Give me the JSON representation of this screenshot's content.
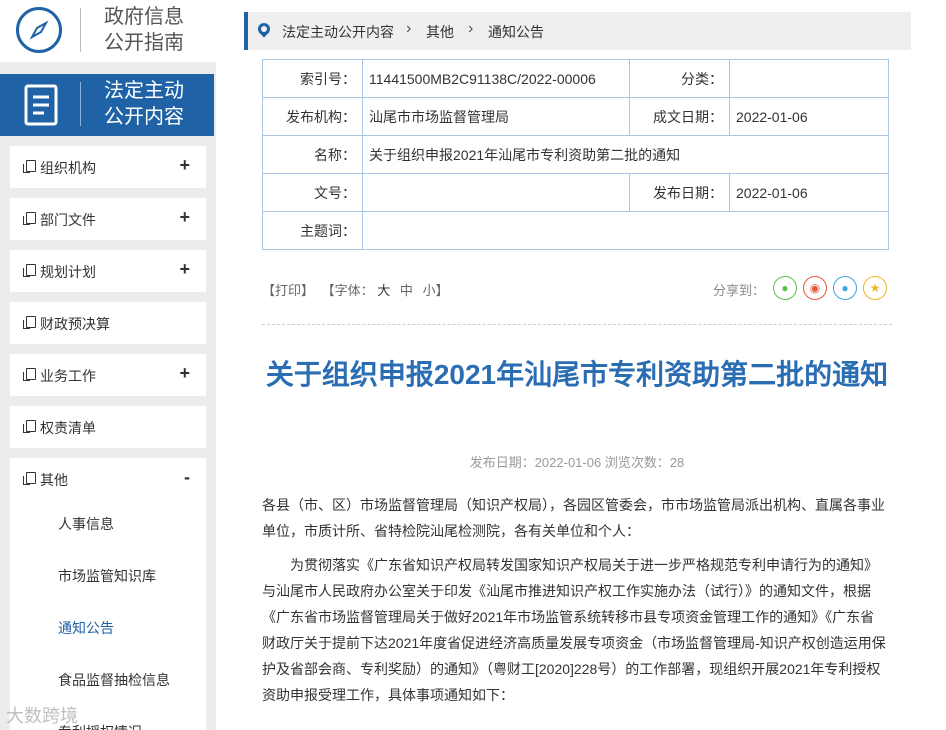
{
  "sidebar": {
    "guide_line1": "政府信息",
    "guide_line2": "公开指南",
    "section_line1": "法定主动",
    "section_line2": "公开内容",
    "menus": [
      {
        "label": "组织机构",
        "toggle": "+"
      },
      {
        "label": "部门文件",
        "toggle": "+"
      },
      {
        "label": "规划计划",
        "toggle": "+"
      },
      {
        "label": "财政预决算",
        "toggle": ""
      },
      {
        "label": "业务工作",
        "toggle": "+"
      },
      {
        "label": "权责清单",
        "toggle": ""
      },
      {
        "label": "其他",
        "toggle": "-"
      }
    ],
    "subs": [
      "人事信息",
      "市场监管知识库",
      "通知公告",
      "食品监督抽检信息",
      "专利授权情况"
    ],
    "watermark": "大数跨境"
  },
  "breadcrumb": [
    "法定主动公开内容",
    "其他",
    "通知公告"
  ],
  "meta": {
    "index_label": "索引号：",
    "index_value": "11441500MB2C91138C/2022-00006",
    "category_label": "分类：",
    "category_value": "",
    "org_label": "发布机构：",
    "org_value": "汕尾市市场监督管理局",
    "date_label": "成文日期：",
    "date_value": "2022-01-06",
    "name_label": "名称：",
    "name_value": "关于组织申报2021年汕尾市专利资助第二批的通知",
    "docno_label": "文号：",
    "docno_value": "",
    "pubdate_label": "发布日期：",
    "pubdate_value": "2022-01-06",
    "keyword_label": "主题词：",
    "keyword_value": ""
  },
  "tools": {
    "print": "【打印】",
    "font_prefix": "【字体：",
    "big": "大",
    "mid": "中",
    "small": "小】",
    "share": "分享到："
  },
  "article": {
    "title": "关于组织申报2021年汕尾市专利资助第二批的通知",
    "pubinfo": "发布日期：2022-01-06  浏览次数：28",
    "p1": "各县（市、区）市场监督管理局（知识产权局），各园区管委会，市市场监管局派出机构、直属各事业单位，市质计所、省特检院汕尾检测院，各有关单位和个人：",
    "p2": "为贯彻落实《广东省知识产权局转发国家知识产权局关于进一步严格规范专利申请行为的通知》与汕尾市人民政府办公室关于印发《汕尾市推进知识产权工作实施办法（试行）》的通知文件，根据《广东省市场监督管理局关于做好2021年市场监管系统转移市县专项资金管理工作的通知》《广东省财政厅关于提前下达2021年度省促进经济高质量发展专项资金（市场监督管理局-知识产权创造运用保护及省部会商、专利奖励）的通知》（粤财工[2020]228号）的工作部署，现组织开展2021年专利授权资助申报受理工作，具体事项通知如下："
  }
}
